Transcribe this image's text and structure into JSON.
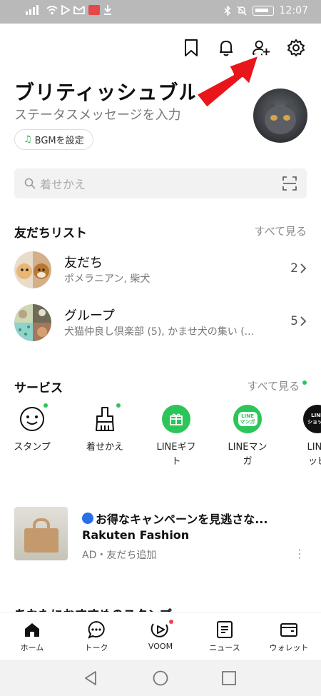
{
  "status_bar": {
    "time": "12:07"
  },
  "header": {
    "icons": [
      "bookmark-icon",
      "bell-icon",
      "add-friend-icon",
      "settings-icon"
    ]
  },
  "profile": {
    "name": "ブリティッシュブルー",
    "status_message": "ステータスメッセージを入力",
    "bgm_label": "BGMを設定"
  },
  "search": {
    "placeholder": "着せかえ"
  },
  "friends_section": {
    "title": "友だちリスト",
    "see_all": "すべて見る",
    "rows": [
      {
        "title": "友だち",
        "subtitle": "ポメラニアン, 柴犬",
        "count": "2"
      },
      {
        "title": "グループ",
        "subtitle": "犬猫仲良し倶楽部 (5), かませ犬の集い (...",
        "count": "5"
      }
    ]
  },
  "services_section": {
    "title": "サービス",
    "see_all": "すべて見る",
    "items": [
      {
        "label": "スタンプ",
        "icon": "smiley-icon"
      },
      {
        "label": "着せかえ",
        "icon": "brush-icon"
      },
      {
        "label": "LINEギフ\nト",
        "icon": "gift-icon"
      },
      {
        "label": "LINEマン\nガ",
        "icon": "manga-icon",
        "badge": "LINE\nマンガ"
      },
      {
        "label": "LINE\nッピ",
        "icon": "shopping-icon",
        "badge": "LINE\nショッピ"
      }
    ]
  },
  "ad": {
    "title": "お得なキャンペーンを見逃さな...",
    "brand": "Rakuten Fashion",
    "label": "AD・友だち追加"
  },
  "cut_section_title": "あなたにおすすめのスタンプ",
  "tabs": [
    {
      "label": "ホーム",
      "icon": "home-icon"
    },
    {
      "label": "トーク",
      "icon": "chat-icon"
    },
    {
      "label": "VOOM",
      "icon": "voom-icon"
    },
    {
      "label": "ニュース",
      "icon": "news-icon"
    },
    {
      "label": "ウォレット",
      "icon": "wallet-icon"
    }
  ],
  "colors": {
    "accent_green": "#2bc559",
    "notification_red": "#f0454b",
    "arrow_red": "#e8151b"
  }
}
